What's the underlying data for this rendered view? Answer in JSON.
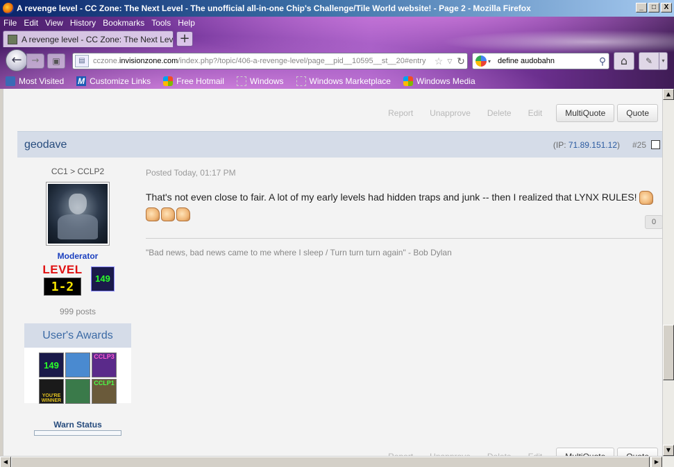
{
  "window": {
    "title": "A revenge level - CC Zone: The Next Level - The unofficial all-in-one Chip's Challenge/Tile World website! - Page 2 - Mozilla Firefox",
    "min_glyph": "_",
    "max_glyph": "□",
    "close_glyph": "X"
  },
  "menus": [
    "File",
    "Edit",
    "View",
    "History",
    "Bookmarks",
    "Tools",
    "Help"
  ],
  "tab": {
    "label": "A revenge level - CC Zone: The Next Level - ...",
    "close_glyph": "×",
    "new_tab_glyph": "+"
  },
  "nav": {
    "back_glyph": "←",
    "forward_glyph": "→",
    "url_prefix": "cczone.",
    "url_domain": "invisionzone.com",
    "url_rest": "/index.php?/topic/406-a-revenge-level/page__pid__10595__st__20#entry",
    "search_value": "define audobahn"
  },
  "bookmarks": [
    "Most Visited",
    "Customize Links",
    "Free Hotmail",
    "Windows",
    "Windows Marketplace",
    "Windows Media"
  ],
  "post_controls": {
    "report": "Report",
    "unapprove": "Unapprove",
    "delete": "Delete",
    "edit": "Edit",
    "multiquote": "MultiQuote",
    "quote": "Quote"
  },
  "post": {
    "author": "geodave",
    "ip_label": "(IP: ",
    "ip": "71.89.151.12",
    "ip_close": ")",
    "number": "#25",
    "date": "Posted Today, 01:17 PM",
    "text": "That's not even close to fair. A lot of my early levels had hidden traps and junk -- then I realized that LYNX RULES!",
    "reputation": "0",
    "signature": "\"Bad news, bad news came to me where I sleep / Turn turn turn again\" - Bob Dylan"
  },
  "user": {
    "rank": "CC1 > CCLP2",
    "role": "Moderator",
    "level_label": "LEVEL",
    "level_value": "1-2",
    "badge": "149",
    "posts": "999 posts",
    "awards_title": "User's Awards",
    "awards": [
      "149",
      "",
      "CCLP3",
      "YOU'RE WINNER",
      "",
      "CCLP1"
    ],
    "warn_status": "Warn Status"
  }
}
